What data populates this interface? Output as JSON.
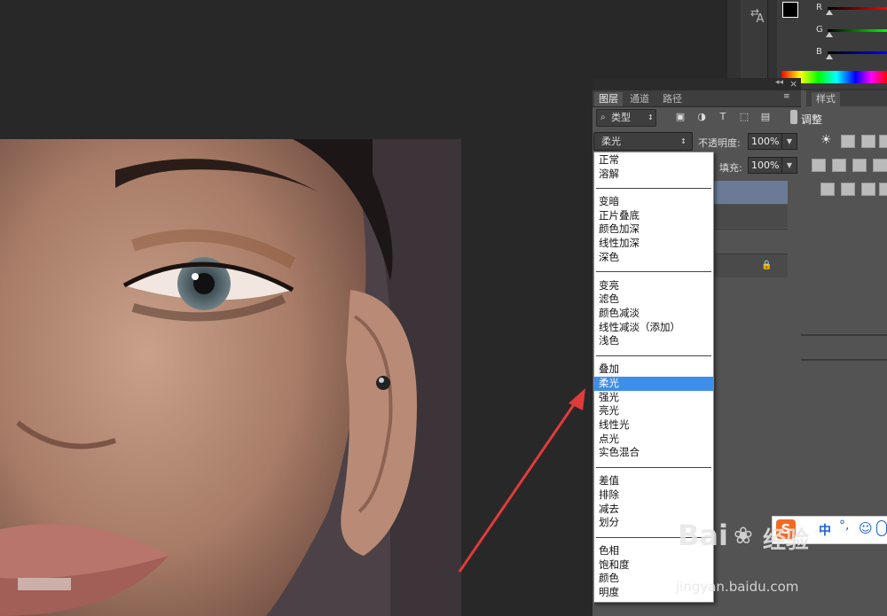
{
  "panel": {
    "tabs": [
      {
        "label": "图层"
      },
      {
        "label": "通道"
      },
      {
        "label": "路径"
      }
    ],
    "filter_label": "类型",
    "blend_mode": "柔光",
    "opacity_label": "不透明度:",
    "opacity_value": "100%",
    "fill_label": "填充:",
    "fill_value": "100%"
  },
  "side": {
    "style_tab": "样式",
    "adjust_title": "调整",
    "color_labels": [
      "R",
      "G",
      "B"
    ]
  },
  "blend_modes": {
    "group1": [
      "正常",
      "溶解"
    ],
    "group2": [
      "变暗",
      "正片叠底",
      "颜色加深",
      "线性加深",
      "深色"
    ],
    "group3": [
      "变亮",
      "滤色",
      "颜色减淡",
      "线性减淡（添加）",
      "浅色"
    ],
    "group4": [
      "叠加",
      "柔光",
      "强光",
      "亮光",
      "线性光",
      "点光",
      "实色混合"
    ],
    "group5": [
      "差值",
      "排除",
      "减去",
      "划分"
    ],
    "group6": [
      "色相",
      "饱和度",
      "颜色",
      "明度"
    ],
    "selected": "柔光"
  },
  "ime": {
    "label": "中"
  },
  "watermark": {
    "brand": "Bai",
    "brand2": "经验",
    "url": "jingyan.baidu.com"
  },
  "colors": {
    "selection": "#3d8ee8",
    "arrow": "#e03b3b",
    "panel_bg": "#535353"
  }
}
